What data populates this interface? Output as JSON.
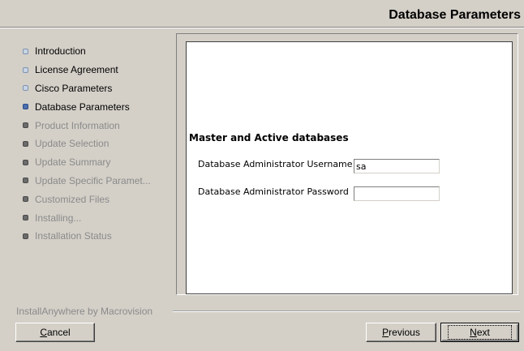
{
  "header": {
    "title": "Database Parameters"
  },
  "steps": [
    {
      "label": "Introduction",
      "state": "done"
    },
    {
      "label": "License Agreement",
      "state": "done"
    },
    {
      "label": "Cisco Parameters",
      "state": "done"
    },
    {
      "label": "Database Parameters",
      "state": "current"
    },
    {
      "label": "Product Information",
      "state": "pending"
    },
    {
      "label": "Update Selection",
      "state": "pending"
    },
    {
      "label": "Update Summary",
      "state": "pending"
    },
    {
      "label": "Update Specific Paramet...",
      "state": "pending"
    },
    {
      "label": "Customized Files",
      "state": "pending"
    },
    {
      "label": "Installing...",
      "state": "pending"
    },
    {
      "label": "Installation Status",
      "state": "pending"
    }
  ],
  "form": {
    "section_title": "Master and Active databases",
    "username_label": "Database Administrator Username",
    "username_value": "sa",
    "password_label": "Database Administrator Password",
    "password_value": ""
  },
  "footer": {
    "vendor": "InstallAnywhere by Macrovision",
    "cancel_first": "C",
    "cancel_rest": "ancel",
    "previous_first": "P",
    "previous_rest": "revious",
    "next_first": "N",
    "next_rest": "ext"
  }
}
